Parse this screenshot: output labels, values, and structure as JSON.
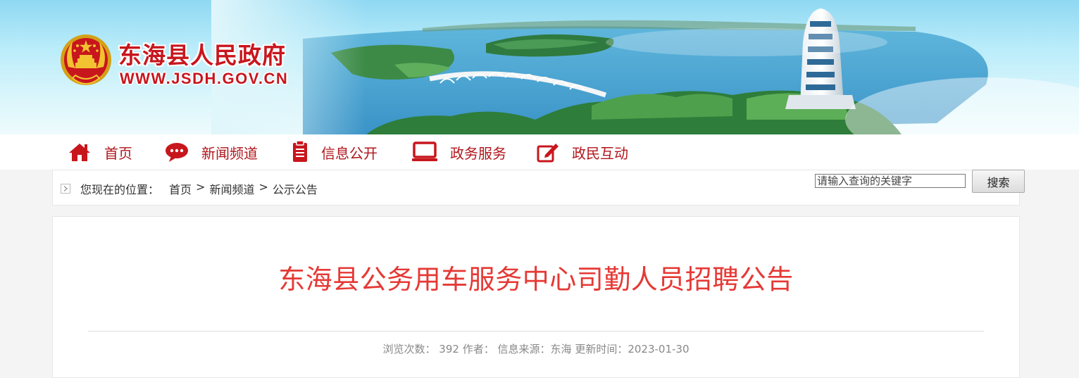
{
  "site": {
    "name": "东海县人民政府",
    "url": "WWW.JSDH.GOV.CN"
  },
  "nav": {
    "items": [
      {
        "label": "首页",
        "icon": "home-icon"
      },
      {
        "label": "新闻频道",
        "icon": "chat-bubble-icon"
      },
      {
        "label": "信息公开",
        "icon": "document-icon"
      },
      {
        "label": "政务服务",
        "icon": "monitor-icon"
      },
      {
        "label": "政民互动",
        "icon": "edit-icon"
      }
    ]
  },
  "breadcrumb": {
    "prefix": "您现在的位置：",
    "items": [
      "首页",
      "新闻频道",
      "公示公告"
    ],
    "separator": ">"
  },
  "search": {
    "placeholder": "请输入查询的关键字",
    "button_label": "搜索"
  },
  "article": {
    "title": "东海县公务用车服务中心司勤人员招聘公告",
    "meta": {
      "views_label": "浏览次数：",
      "views": "392",
      "author_label": "作者：",
      "author": "",
      "source_label": "信息来源：",
      "source": "东海",
      "updated_label": "更新时间：",
      "updated": "2023-01-30"
    }
  },
  "colors": {
    "brand_red": "#c8161d",
    "title_red": "#e53935",
    "nav_red": "#b0161c"
  }
}
